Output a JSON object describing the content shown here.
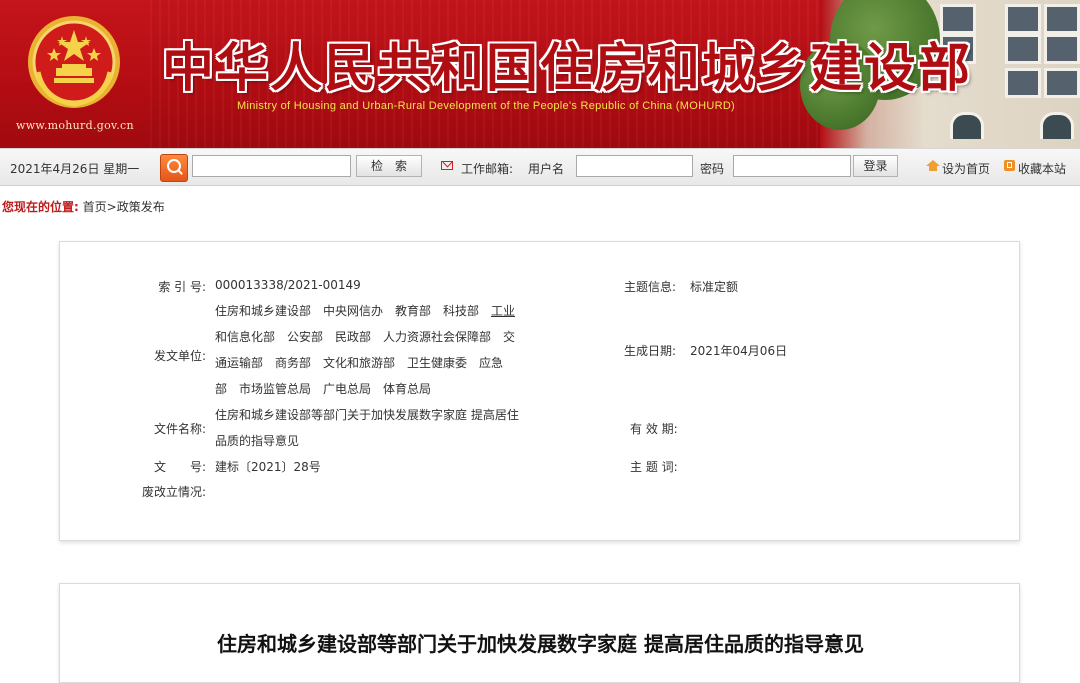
{
  "header": {
    "site_url": "www.mohurd.gov.cn",
    "title_cn": "中华人民共和国住房和城乡建设部",
    "title_en": "Ministry of Housing and Urban-Rural Development of the People's Republic of China (MOHURD)"
  },
  "toolbar": {
    "date": "2021年4月26日 星期一",
    "search_value": "",
    "search_button": "检　索",
    "mail_label": "工作邮箱:",
    "username_label": "用户名",
    "username_value": "",
    "password_label": "密码",
    "password_value": "",
    "login_button": "登录",
    "set_home": "设为首页",
    "bookmark": "收藏本站"
  },
  "breadcrumb": {
    "label": "您现在的位置:",
    "path": "首页>政策发布"
  },
  "info": {
    "index_label": "索 引 号:",
    "index_value": "000013338/2021-00149",
    "topic_label": "主题信息:",
    "topic_value": "标准定额",
    "issuer_label": "发文单位:",
    "issuers_line1": "住房和城乡建设部　中央网信办　教育部　科技部　",
    "issuers_line1_u": "工业",
    "issuers_line2": "和信息化部　公安部　民政部　人力资源社会保障部　交",
    "issuers_line3": "通运输部　商务部　文化和旅游部　卫生健康委　应急",
    "issuers_line4": "部　市场监管总局　广电总局　体育总局",
    "created_label": "生成日期:",
    "created_value": "2021年04月06日",
    "filename_label": "文件名称:",
    "filename_line1": "住房和城乡建设部等部门关于加快发展数字家庭 提高居住",
    "filename_line2": "品质的指导意见",
    "validity_label": "有 效 期:",
    "validity_value": "",
    "docno_label": "文　　号:",
    "docno_value": "建标〔2021〕28号",
    "keywords_label": "主 题 词:",
    "keywords_value": "",
    "status_label": "废改立情况:",
    "status_value": ""
  },
  "article": {
    "title": "住房和城乡建设部等部门关于加快发展数字家庭 提高居住品质的指导意见"
  },
  "colors": {
    "brand_red": "#b40d13",
    "breadcrumb_red": "#c01b1b",
    "english_title_yellow": "#f7e34a"
  },
  "icons": [
    "national-emblem-icon",
    "search-icon",
    "mail-icon",
    "home-icon",
    "bookmark-icon"
  ]
}
